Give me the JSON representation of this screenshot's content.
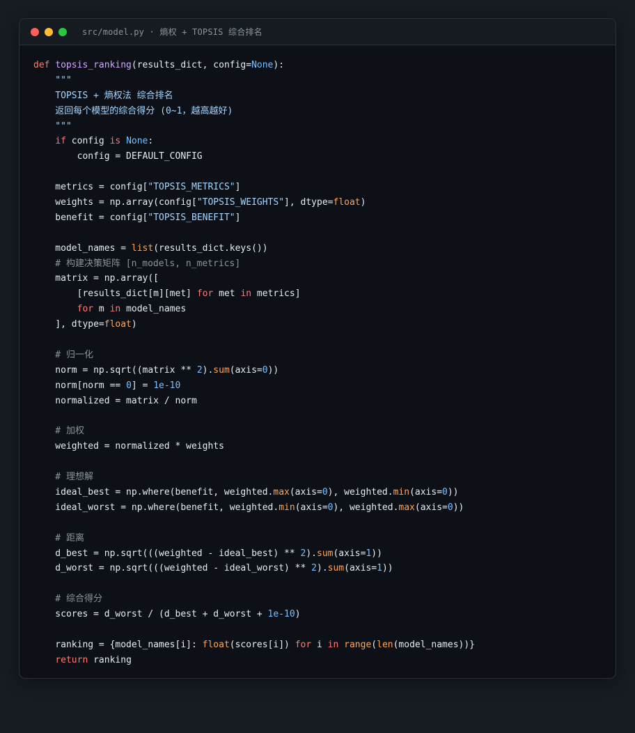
{
  "window": {
    "title": "src/model.py · 熵权 + TOPSIS 综合排名",
    "controls": {
      "close_color": "#ff5f57",
      "minimize_color": "#febc2e",
      "maximize_color": "#28c840"
    }
  },
  "code": {
    "language": "python",
    "lines": [
      [
        [
          "kw",
          "def"
        ],
        [
          "pl",
          " "
        ],
        [
          "fn",
          "topsis_ranking"
        ],
        [
          "pl",
          "(results_dict, config="
        ],
        [
          "cn",
          "None"
        ],
        [
          "pl",
          "):"
        ]
      ],
      [
        [
          "st",
          "    \"\"\""
        ]
      ],
      [
        [
          "st",
          "    TOPSIS + 熵权法 综合排名"
        ]
      ],
      [
        [
          "st",
          "    返回每个模型的综合得分 (0~1，越高越好)"
        ]
      ],
      [
        [
          "st",
          "    \"\"\""
        ]
      ],
      [
        [
          "pl",
          "    "
        ],
        [
          "kw",
          "if"
        ],
        [
          "pl",
          " config "
        ],
        [
          "kw",
          "is"
        ],
        [
          "pl",
          " "
        ],
        [
          "cn",
          "None"
        ],
        [
          "pl",
          ":"
        ]
      ],
      [
        [
          "pl",
          "        config = DEFAULT_CONFIG"
        ]
      ],
      [],
      [
        [
          "pl",
          "    metrics = config["
        ],
        [
          "st",
          "\"TOPSIS_METRICS\""
        ],
        [
          "pl",
          "]"
        ]
      ],
      [
        [
          "pl",
          "    weights = np.array(config["
        ],
        [
          "st",
          "\"TOPSIS_WEIGHTS\""
        ],
        [
          "pl",
          "], dtype="
        ],
        [
          "bi",
          "float"
        ],
        [
          "pl",
          ")"
        ]
      ],
      [
        [
          "pl",
          "    benefit = config["
        ],
        [
          "st",
          "\"TOPSIS_BENEFIT\""
        ],
        [
          "pl",
          "]"
        ]
      ],
      [],
      [
        [
          "pl",
          "    model_names = "
        ],
        [
          "bi",
          "list"
        ],
        [
          "pl",
          "(results_dict.keys())"
        ]
      ],
      [
        [
          "cm",
          "    # 构建决策矩阵 [n_models, n_metrics]"
        ]
      ],
      [
        [
          "pl",
          "    matrix = np.array(["
        ]
      ],
      [
        [
          "pl",
          "        [results_dict[m][met] "
        ],
        [
          "kw",
          "for"
        ],
        [
          "pl",
          " met "
        ],
        [
          "kw",
          "in"
        ],
        [
          "pl",
          " metrics]"
        ]
      ],
      [
        [
          "pl",
          "        "
        ],
        [
          "kw",
          "for"
        ],
        [
          "pl",
          " m "
        ],
        [
          "kw",
          "in"
        ],
        [
          "pl",
          " model_names"
        ]
      ],
      [
        [
          "pl",
          "    ], dtype="
        ],
        [
          "bi",
          "float"
        ],
        [
          "pl",
          ")"
        ]
      ],
      [],
      [
        [
          "cm",
          "    # 归一化"
        ]
      ],
      [
        [
          "pl",
          "    norm = np.sqrt((matrix ** "
        ],
        [
          "nm",
          "2"
        ],
        [
          "pl",
          ")."
        ],
        [
          "bi",
          "sum"
        ],
        [
          "pl",
          "(axis="
        ],
        [
          "nm",
          "0"
        ],
        [
          "pl",
          "))"
        ]
      ],
      [
        [
          "pl",
          "    norm[norm == "
        ],
        [
          "nm",
          "0"
        ],
        [
          "pl",
          "] = "
        ],
        [
          "nm",
          "1e-10"
        ]
      ],
      [
        [
          "pl",
          "    normalized = matrix / norm"
        ]
      ],
      [],
      [
        [
          "cm",
          "    # 加权"
        ]
      ],
      [
        [
          "pl",
          "    weighted = normalized * weights"
        ]
      ],
      [],
      [
        [
          "cm",
          "    # 理想解"
        ]
      ],
      [
        [
          "pl",
          "    ideal_best = np.where(benefit, weighted."
        ],
        [
          "bi",
          "max"
        ],
        [
          "pl",
          "(axis="
        ],
        [
          "nm",
          "0"
        ],
        [
          "pl",
          "), weighted."
        ],
        [
          "bi",
          "min"
        ],
        [
          "pl",
          "(axis="
        ],
        [
          "nm",
          "0"
        ],
        [
          "pl",
          "))"
        ]
      ],
      [
        [
          "pl",
          "    ideal_worst = np.where(benefit, weighted."
        ],
        [
          "bi",
          "min"
        ],
        [
          "pl",
          "(axis="
        ],
        [
          "nm",
          "0"
        ],
        [
          "pl",
          "), weighted."
        ],
        [
          "bi",
          "max"
        ],
        [
          "pl",
          "(axis="
        ],
        [
          "nm",
          "0"
        ],
        [
          "pl",
          "))"
        ]
      ],
      [],
      [
        [
          "cm",
          "    # 距离"
        ]
      ],
      [
        [
          "pl",
          "    d_best = np.sqrt(((weighted - ideal_best) ** "
        ],
        [
          "nm",
          "2"
        ],
        [
          "pl",
          ")."
        ],
        [
          "bi",
          "sum"
        ],
        [
          "pl",
          "(axis="
        ],
        [
          "nm",
          "1"
        ],
        [
          "pl",
          "))"
        ]
      ],
      [
        [
          "pl",
          "    d_worst = np.sqrt(((weighted - ideal_worst) ** "
        ],
        [
          "nm",
          "2"
        ],
        [
          "pl",
          ")."
        ],
        [
          "bi",
          "sum"
        ],
        [
          "pl",
          "(axis="
        ],
        [
          "nm",
          "1"
        ],
        [
          "pl",
          "))"
        ]
      ],
      [],
      [
        [
          "cm",
          "    # 综合得分"
        ]
      ],
      [
        [
          "pl",
          "    scores = d_worst / (d_best + d_worst + "
        ],
        [
          "nm",
          "1e-10"
        ],
        [
          "pl",
          ")"
        ]
      ],
      [],
      [
        [
          "pl",
          "    ranking = {model_names[i]: "
        ],
        [
          "bi",
          "float"
        ],
        [
          "pl",
          "(scores[i]) "
        ],
        [
          "kw",
          "for"
        ],
        [
          "pl",
          " i "
        ],
        [
          "kw",
          "in"
        ],
        [
          "pl",
          " "
        ],
        [
          "bi",
          "range"
        ],
        [
          "pl",
          "("
        ],
        [
          "bi",
          "len"
        ],
        [
          "pl",
          "(model_names))}"
        ]
      ],
      [
        [
          "pl",
          "    "
        ],
        [
          "kw",
          "return"
        ],
        [
          "pl",
          " ranking"
        ]
      ]
    ]
  }
}
